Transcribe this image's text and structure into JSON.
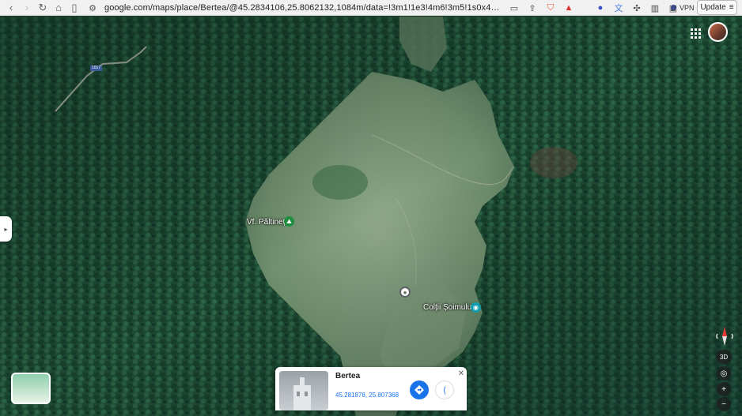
{
  "browser": {
    "url": "google.com/maps/place/Bertea/@45.2834106,25.8062132,1084m/data=!3m1!1e3!4m6!3m5!1s0x40b3081ccf8693...",
    "vpn_label": "VPN",
    "update_label": "Update",
    "icons": [
      "back-icon",
      "forward-icon",
      "home-icon",
      "bookmark-icon",
      "site-settings-icon",
      "cast-icon",
      "share-icon",
      "brave-shield-icon",
      "rewards-icon",
      "extension-icon",
      "translate-icon",
      "puzzle-icon",
      "sidebar-icon",
      "wallet-icon",
      "menu-icon"
    ]
  },
  "map": {
    "labels": {
      "peak": "Vf. Păltineț",
      "landmark": "Colții Șoimului",
      "road": "1017"
    },
    "controls": {
      "three_d": "3D"
    }
  },
  "place_card": {
    "title": "Bertea",
    "coordinates": "45.281878, 25.807368"
  },
  "colors": {
    "accent": "#1a73e8",
    "poi_green": "#1e8e3e",
    "poi_teal": "#129eaf"
  }
}
